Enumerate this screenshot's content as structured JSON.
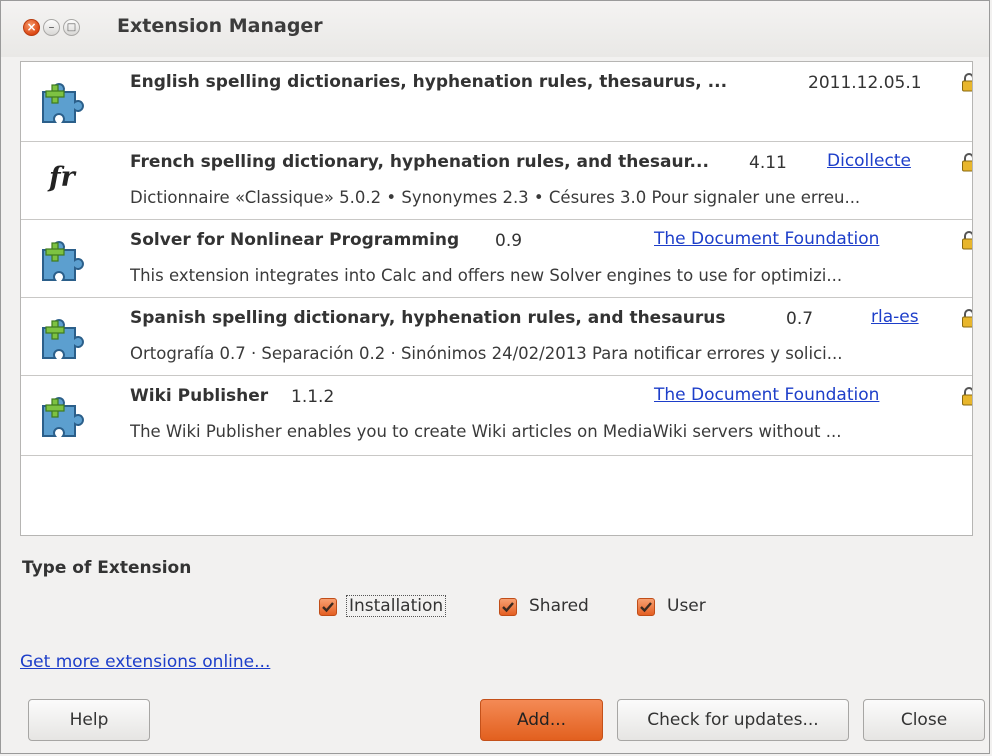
{
  "window": {
    "title": "Extension Manager"
  },
  "extensions": [
    {
      "icon": "puzzle-icon",
      "name": "English spelling dictionaries, hyphenation rules, thesaurus, ...",
      "version": "2011.12.05.1",
      "publisher": "",
      "description": "",
      "locked": true
    },
    {
      "icon": "fr-icon",
      "icon_text": "fr",
      "name": "French spelling dictionary, hyphenation rules, and thesaur...",
      "version": "4.11",
      "publisher": "Dicollecte",
      "description": "Dictionnaire «Classique» 5.0.2 • Synonymes 2.3 • Césures 3.0  Pour signaler une erreu...",
      "locked": true
    },
    {
      "icon": "puzzle-icon",
      "name": "Solver for Nonlinear Programming",
      "version": "0.9",
      "publisher": "The Document Foundation",
      "description": "This extension integrates into Calc and offers new Solver engines to use for optimizi...",
      "locked": true
    },
    {
      "icon": "puzzle-icon",
      "name": "Spanish spelling dictionary, hyphenation rules, and thesaurus",
      "version": "0.7",
      "publisher": "rla-es",
      "description": "Ortografía 0.7 · Separación 0.2 · Sinónimos 24/02/2013  Para notificar errores y solici...",
      "locked": true
    },
    {
      "icon": "puzzle-icon",
      "name": "Wiki Publisher",
      "version": "1.1.2",
      "publisher": "The Document Foundation",
      "description": "The Wiki Publisher enables you to create Wiki articles on MediaWiki servers without ...",
      "locked": true
    }
  ],
  "filter": {
    "section_title": "Type of Extension",
    "options": [
      {
        "label": "Installation",
        "checked": true
      },
      {
        "label": "Shared",
        "checked": true
      },
      {
        "label": "User",
        "checked": true
      }
    ]
  },
  "get_more_link": "Get more extensions online...",
  "buttons": {
    "help": "Help",
    "add": "Add...",
    "check_updates": "Check for updates...",
    "close": "Close"
  },
  "colors": {
    "accent": "#e2601f",
    "link": "#1d3ec9"
  }
}
